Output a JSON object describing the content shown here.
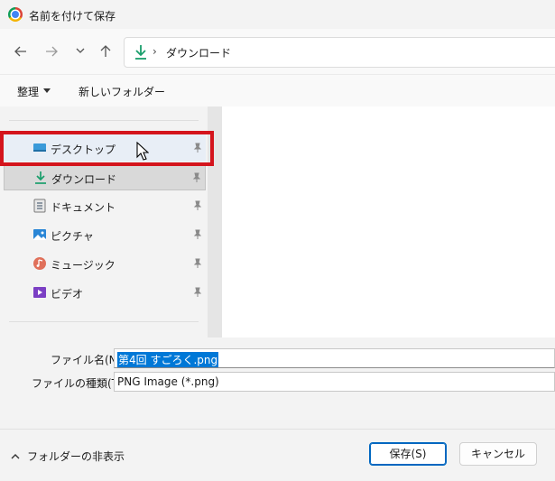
{
  "window": {
    "title": "名前を付けて保存"
  },
  "address": {
    "path_icon": "download-icon",
    "separator": "›",
    "location": "ダウンロード"
  },
  "toolbar": {
    "organize_label": "整理",
    "new_folder_label": "新しいフォルダー"
  },
  "sidebar": {
    "items": [
      {
        "label": "デスクトップ",
        "icon": "desktop-icon",
        "pinned": true,
        "state": "hover"
      },
      {
        "label": "ダウンロード",
        "icon": "download-icon",
        "pinned": true,
        "state": "selected"
      },
      {
        "label": "ドキュメント",
        "icon": "document-icon",
        "pinned": true
      },
      {
        "label": "ピクチャ",
        "icon": "pictures-icon",
        "pinned": true
      },
      {
        "label": "ミュージック",
        "icon": "music-icon",
        "pinned": true
      },
      {
        "label": "ビデオ",
        "icon": "video-icon",
        "pinned": true
      }
    ]
  },
  "form": {
    "filename_label": "ファイル名(N):",
    "filename_value": "第4回 すごろく.png",
    "filetype_label": "ファイルの種類(T):",
    "filetype_value": "PNG Image (*.png)"
  },
  "footer": {
    "hide_folders_label": "フォルダーの非表示",
    "save_label": "保存(S)",
    "cancel_label": "キャンセル"
  },
  "colors": {
    "accent": "#0067c0",
    "highlight_box": "#d4141c",
    "selection": "#0078d7"
  }
}
